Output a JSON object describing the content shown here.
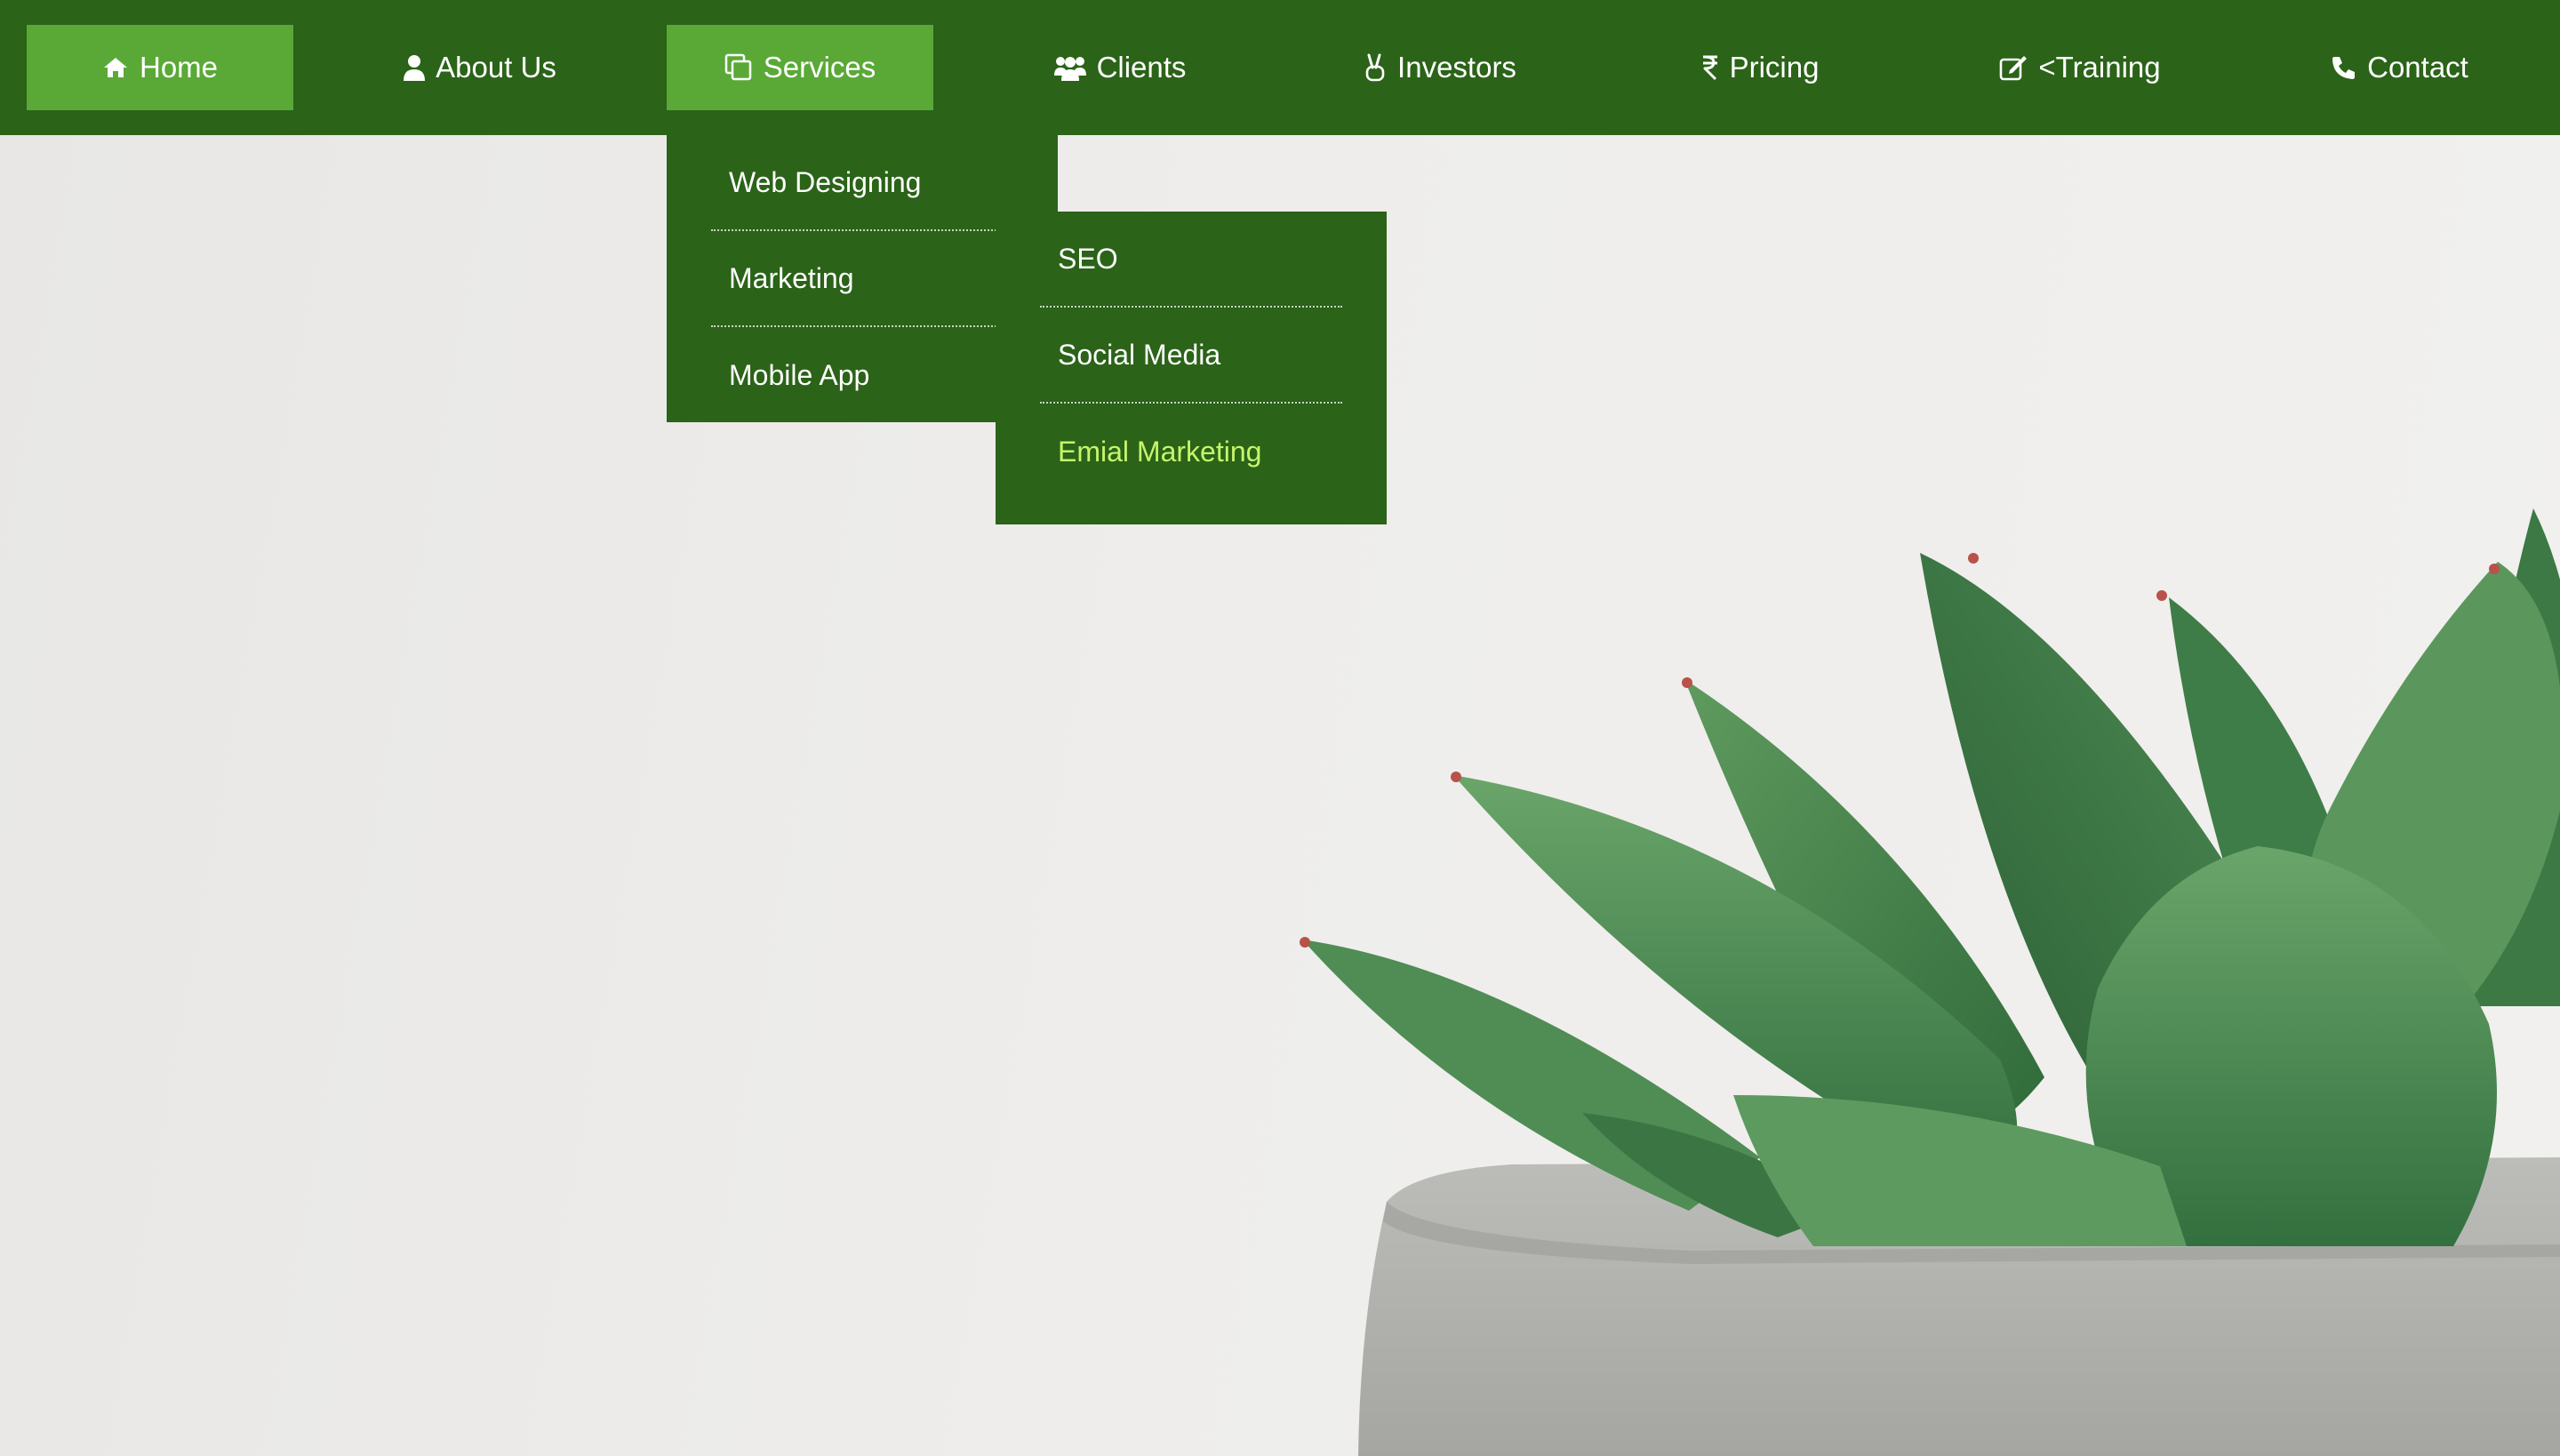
{
  "nav": {
    "items": [
      {
        "label": "Home",
        "icon": "home-icon",
        "active": true
      },
      {
        "label": "About Us",
        "icon": "user-icon",
        "active": false
      },
      {
        "label": "Services",
        "icon": "copy-icon",
        "active": true
      },
      {
        "label": "Clients",
        "icon": "users-icon",
        "active": false
      },
      {
        "label": "Investors",
        "icon": "hand-peace-icon",
        "active": false
      },
      {
        "label": "Pricing",
        "icon": "rupee-icon",
        "active": false
      },
      {
        "label": "<Training",
        "icon": "edit-icon",
        "active": false
      },
      {
        "label": "Contact",
        "icon": "phone-icon",
        "active": false
      }
    ]
  },
  "services_menu": {
    "items": [
      {
        "label": "Web Designing",
        "has_submenu": false
      },
      {
        "label": "Marketing",
        "has_submenu": true
      },
      {
        "label": "Mobile App",
        "has_submenu": true
      }
    ]
  },
  "marketing_submenu": {
    "items": [
      {
        "label": "SEO"
      },
      {
        "label": "Social Media"
      },
      {
        "label": "Emial Marketing"
      }
    ]
  },
  "colors": {
    "nav_bg": "#2b6318",
    "active_bg": "#5aa937",
    "highlight_text": "#c6f56b",
    "text": "#ffffff"
  }
}
